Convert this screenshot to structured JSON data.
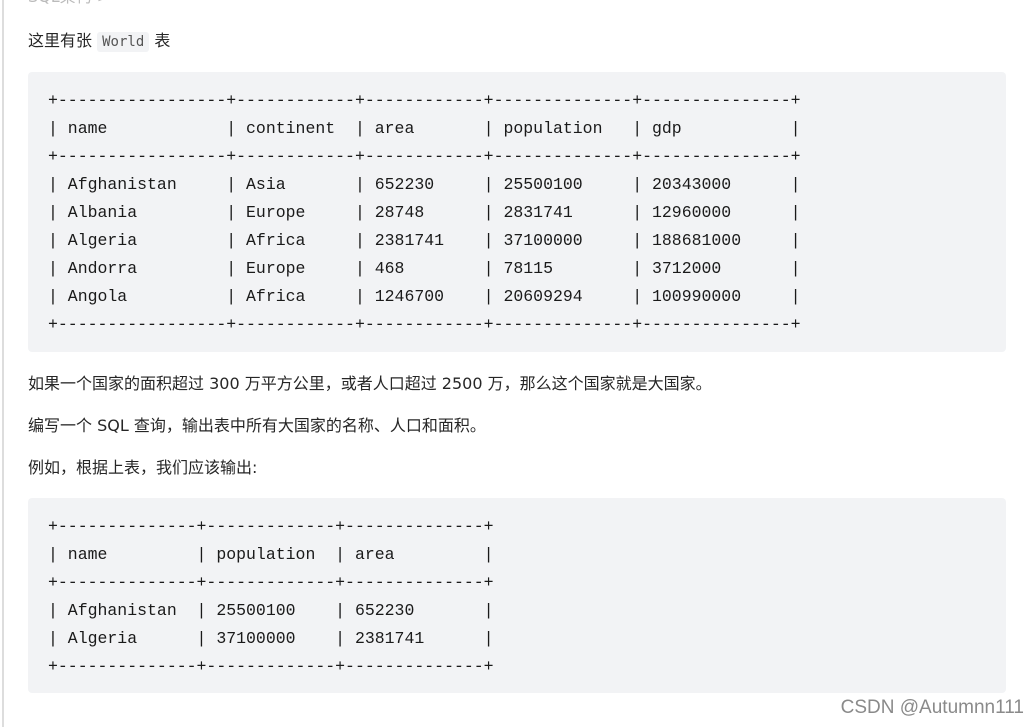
{
  "top_cut_text": "SQL架构 >",
  "intro": {
    "before": "这里有张",
    "code": "World",
    "after": "表"
  },
  "world_table": {
    "columns": [
      "name",
      "continent",
      "area",
      "population",
      "gdp"
    ],
    "rows": [
      [
        "Afghanistan",
        "Asia",
        "652230",
        "25500100",
        "20343000"
      ],
      [
        "Albania",
        "Europe",
        "28748",
        "2831741",
        "12960000"
      ],
      [
        "Algeria",
        "Africa",
        "2381741",
        "37100000",
        "188681000"
      ],
      [
        "Andorra",
        "Europe",
        "468",
        "78115",
        "3712000"
      ],
      [
        "Angola",
        "Africa",
        "1246700",
        "20609294",
        "100990000"
      ]
    ]
  },
  "paragraphs": [
    "如果一个国家的面积超过 300 万平方公里，或者人口超过 2500 万，那么这个国家就是大国家。",
    "编写一个 SQL 查询，输出表中所有大国家的名称、人口和面积。",
    "例如，根据上表，我们应该输出:"
  ],
  "output_table": {
    "columns": [
      "name",
      "population",
      "area"
    ],
    "rows": [
      [
        "Afghanistan",
        "25500100",
        "652230"
      ],
      [
        "Algeria",
        "37100000",
        "2381741"
      ]
    ]
  },
  "watermark": "CSDN @Autumnn111"
}
